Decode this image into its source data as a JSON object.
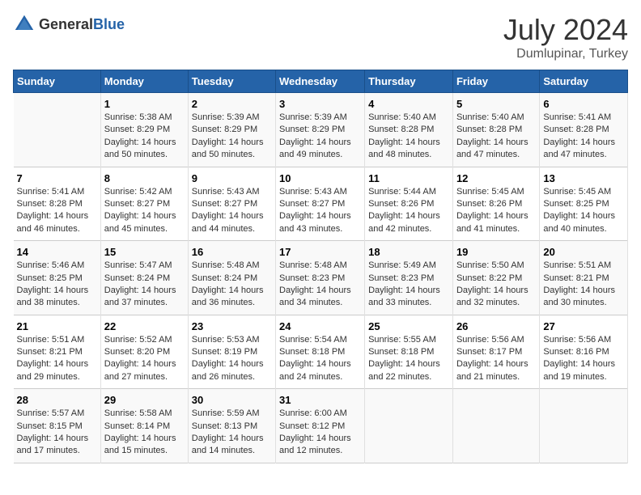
{
  "header": {
    "logo": {
      "general": "General",
      "blue": "Blue"
    },
    "title": "July 2024",
    "subtitle": "Dumlupinar, Turkey"
  },
  "calendar": {
    "days_of_week": [
      "Sunday",
      "Monday",
      "Tuesday",
      "Wednesday",
      "Thursday",
      "Friday",
      "Saturday"
    ],
    "weeks": [
      [
        {
          "day": "",
          "info": ""
        },
        {
          "day": "1",
          "info": "Sunrise: 5:38 AM\nSunset: 8:29 PM\nDaylight: 14 hours and 50 minutes."
        },
        {
          "day": "2",
          "info": "Sunrise: 5:39 AM\nSunset: 8:29 PM\nDaylight: 14 hours and 50 minutes."
        },
        {
          "day": "3",
          "info": "Sunrise: 5:39 AM\nSunset: 8:29 PM\nDaylight: 14 hours and 49 minutes."
        },
        {
          "day": "4",
          "info": "Sunrise: 5:40 AM\nSunset: 8:28 PM\nDaylight: 14 hours and 48 minutes."
        },
        {
          "day": "5",
          "info": "Sunrise: 5:40 AM\nSunset: 8:28 PM\nDaylight: 14 hours and 47 minutes."
        },
        {
          "day": "6",
          "info": "Sunrise: 5:41 AM\nSunset: 8:28 PM\nDaylight: 14 hours and 47 minutes."
        }
      ],
      [
        {
          "day": "7",
          "info": "Sunrise: 5:41 AM\nSunset: 8:28 PM\nDaylight: 14 hours and 46 minutes."
        },
        {
          "day": "8",
          "info": "Sunrise: 5:42 AM\nSunset: 8:27 PM\nDaylight: 14 hours and 45 minutes."
        },
        {
          "day": "9",
          "info": "Sunrise: 5:43 AM\nSunset: 8:27 PM\nDaylight: 14 hours and 44 minutes."
        },
        {
          "day": "10",
          "info": "Sunrise: 5:43 AM\nSunset: 8:27 PM\nDaylight: 14 hours and 43 minutes."
        },
        {
          "day": "11",
          "info": "Sunrise: 5:44 AM\nSunset: 8:26 PM\nDaylight: 14 hours and 42 minutes."
        },
        {
          "day": "12",
          "info": "Sunrise: 5:45 AM\nSunset: 8:26 PM\nDaylight: 14 hours and 41 minutes."
        },
        {
          "day": "13",
          "info": "Sunrise: 5:45 AM\nSunset: 8:25 PM\nDaylight: 14 hours and 40 minutes."
        }
      ],
      [
        {
          "day": "14",
          "info": "Sunrise: 5:46 AM\nSunset: 8:25 PM\nDaylight: 14 hours and 38 minutes."
        },
        {
          "day": "15",
          "info": "Sunrise: 5:47 AM\nSunset: 8:24 PM\nDaylight: 14 hours and 37 minutes."
        },
        {
          "day": "16",
          "info": "Sunrise: 5:48 AM\nSunset: 8:24 PM\nDaylight: 14 hours and 36 minutes."
        },
        {
          "day": "17",
          "info": "Sunrise: 5:48 AM\nSunset: 8:23 PM\nDaylight: 14 hours and 34 minutes."
        },
        {
          "day": "18",
          "info": "Sunrise: 5:49 AM\nSunset: 8:23 PM\nDaylight: 14 hours and 33 minutes."
        },
        {
          "day": "19",
          "info": "Sunrise: 5:50 AM\nSunset: 8:22 PM\nDaylight: 14 hours and 32 minutes."
        },
        {
          "day": "20",
          "info": "Sunrise: 5:51 AM\nSunset: 8:21 PM\nDaylight: 14 hours and 30 minutes."
        }
      ],
      [
        {
          "day": "21",
          "info": "Sunrise: 5:51 AM\nSunset: 8:21 PM\nDaylight: 14 hours and 29 minutes."
        },
        {
          "day": "22",
          "info": "Sunrise: 5:52 AM\nSunset: 8:20 PM\nDaylight: 14 hours and 27 minutes."
        },
        {
          "day": "23",
          "info": "Sunrise: 5:53 AM\nSunset: 8:19 PM\nDaylight: 14 hours and 26 minutes."
        },
        {
          "day": "24",
          "info": "Sunrise: 5:54 AM\nSunset: 8:18 PM\nDaylight: 14 hours and 24 minutes."
        },
        {
          "day": "25",
          "info": "Sunrise: 5:55 AM\nSunset: 8:18 PM\nDaylight: 14 hours and 22 minutes."
        },
        {
          "day": "26",
          "info": "Sunrise: 5:56 AM\nSunset: 8:17 PM\nDaylight: 14 hours and 21 minutes."
        },
        {
          "day": "27",
          "info": "Sunrise: 5:56 AM\nSunset: 8:16 PM\nDaylight: 14 hours and 19 minutes."
        }
      ],
      [
        {
          "day": "28",
          "info": "Sunrise: 5:57 AM\nSunset: 8:15 PM\nDaylight: 14 hours and 17 minutes."
        },
        {
          "day": "29",
          "info": "Sunrise: 5:58 AM\nSunset: 8:14 PM\nDaylight: 14 hours and 15 minutes."
        },
        {
          "day": "30",
          "info": "Sunrise: 5:59 AM\nSunset: 8:13 PM\nDaylight: 14 hours and 14 minutes."
        },
        {
          "day": "31",
          "info": "Sunrise: 6:00 AM\nSunset: 8:12 PM\nDaylight: 14 hours and 12 minutes."
        },
        {
          "day": "",
          "info": ""
        },
        {
          "day": "",
          "info": ""
        },
        {
          "day": "",
          "info": ""
        }
      ]
    ]
  }
}
